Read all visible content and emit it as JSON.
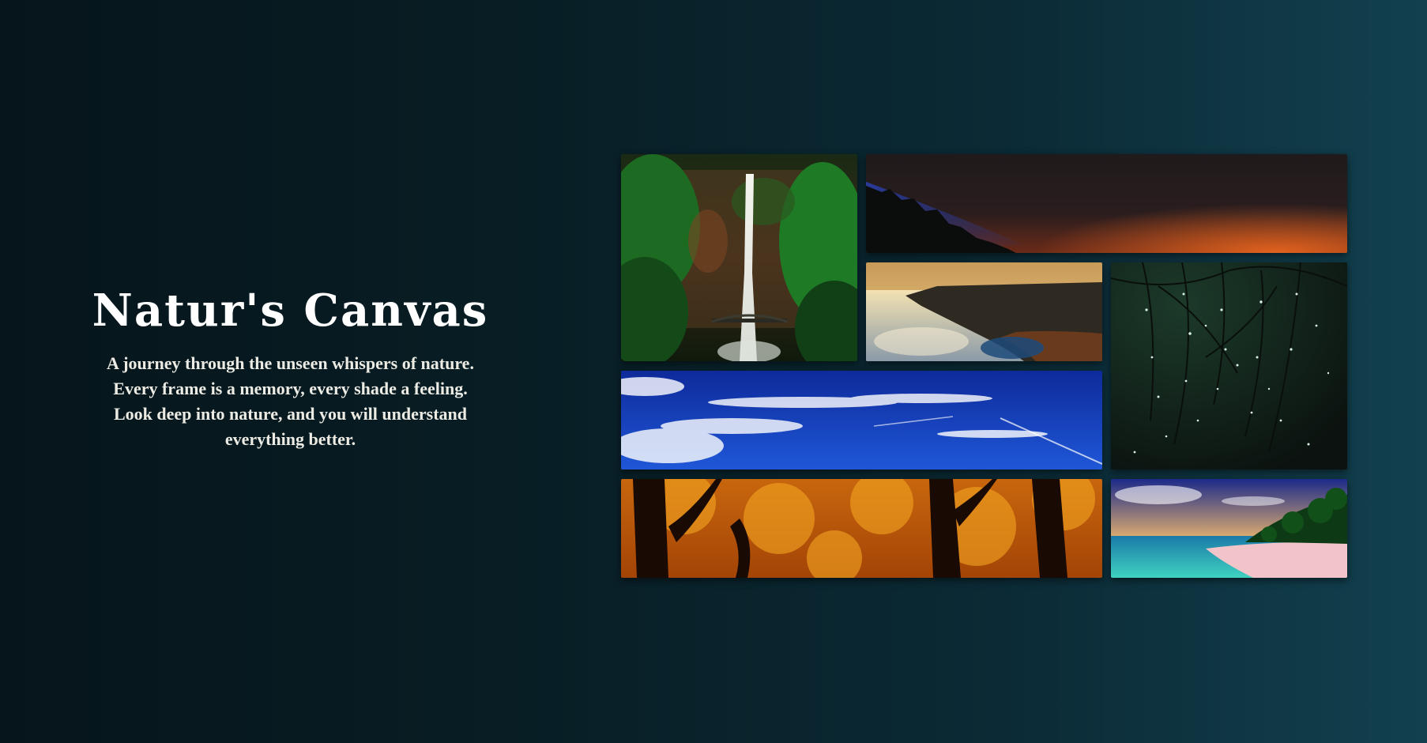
{
  "hero": {
    "title": "Natur's Canvas",
    "description_lines": [
      "A journey through the unseen whispers of nature.",
      "Every frame is a memory, every shade a feeling.",
      "Look deep into nature, and you will understand",
      "everything better."
    ]
  },
  "gallery": {
    "images": [
      {
        "subject": "waterfall-forest",
        "icon": "waterfall-photo"
      },
      {
        "subject": "dusk-sky-silhouette",
        "icon": "dusk-photo"
      },
      {
        "subject": "sea-cliffs-sunset",
        "icon": "coast-photo"
      },
      {
        "subject": "dewdrops-on-branches",
        "icon": "dew-photo"
      },
      {
        "subject": "blue-sky-clouds",
        "icon": "sky-photo"
      },
      {
        "subject": "autumn-trees",
        "icon": "autumn-photo"
      },
      {
        "subject": "tropical-beach",
        "icon": "beach-photo"
      }
    ]
  },
  "colors": {
    "background_left": "#06151b",
    "background_right": "#12404f",
    "title": "#ffffff",
    "text": "#ecebe4"
  }
}
